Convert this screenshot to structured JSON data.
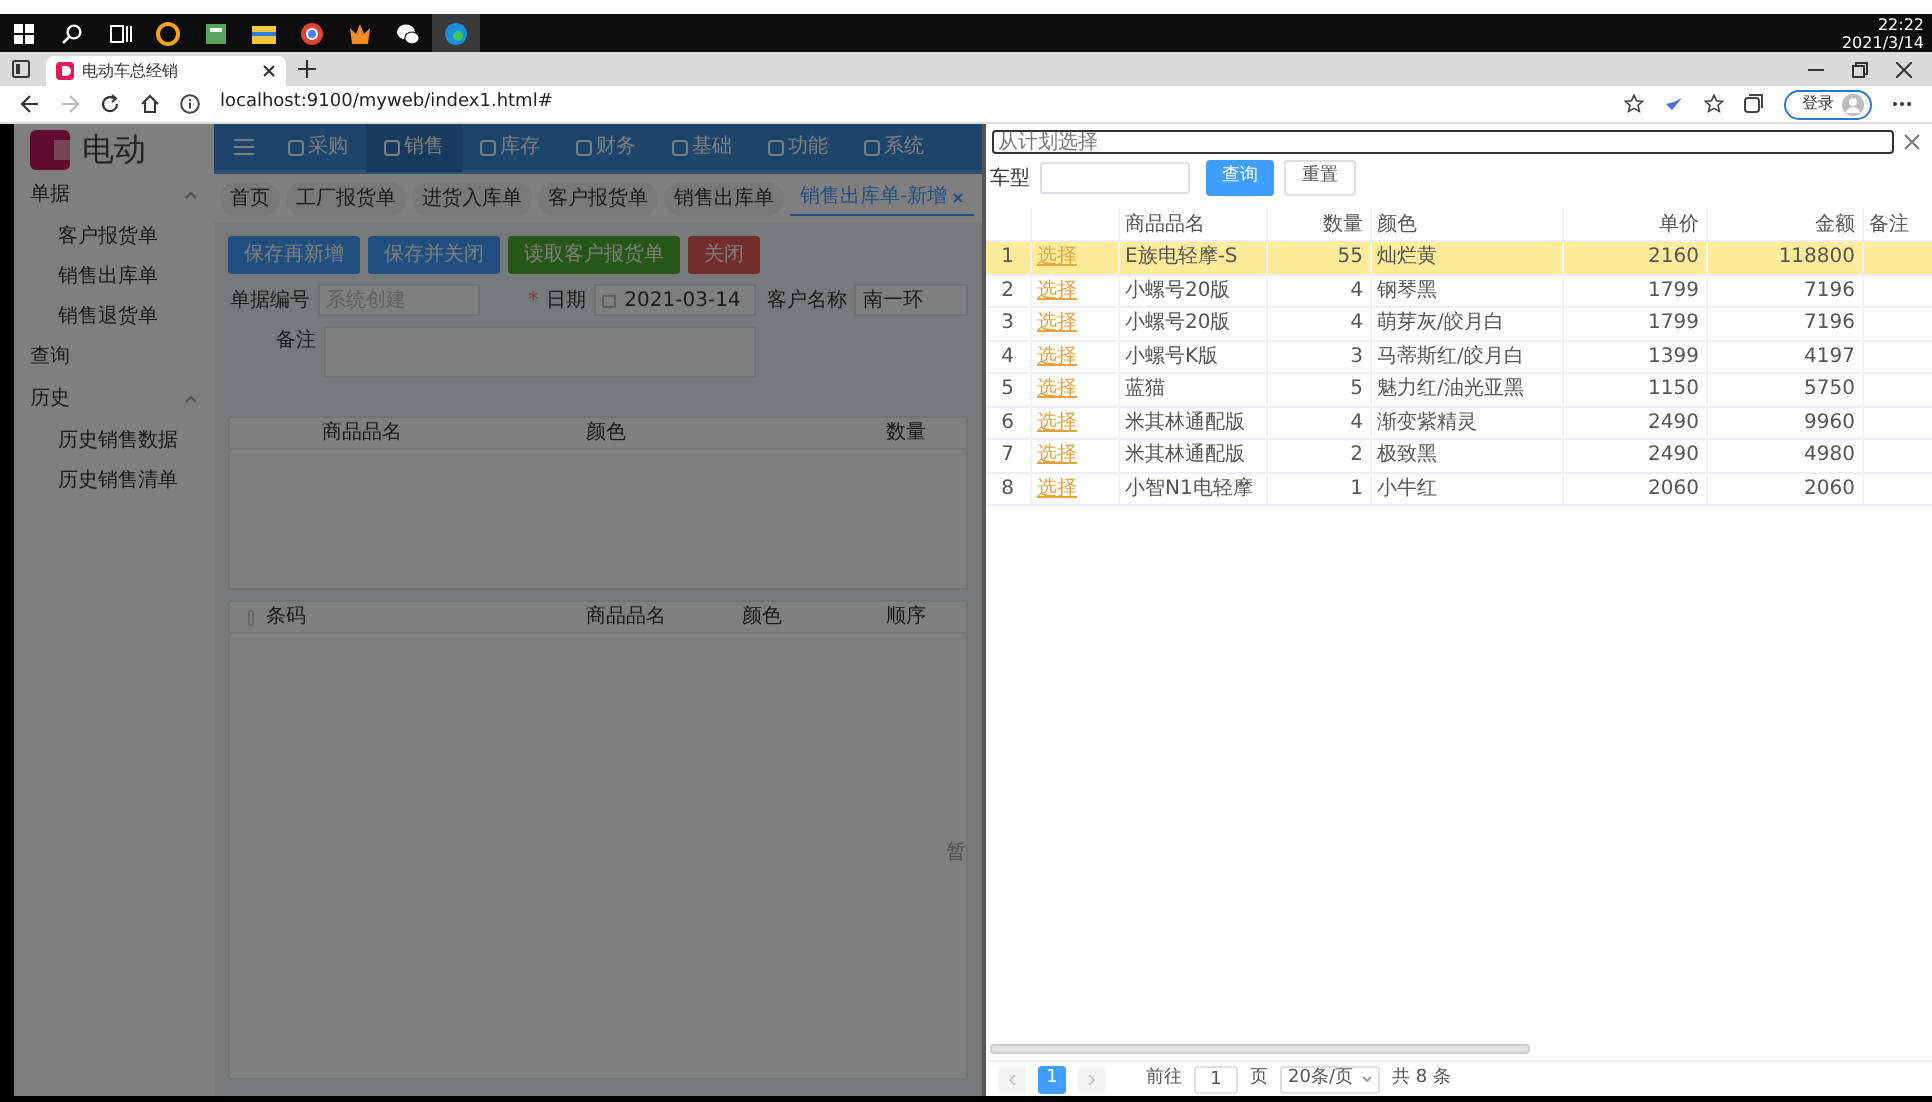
{
  "taskbar": {
    "clock_time": "22:22",
    "clock_date": "2021/3/14"
  },
  "browser": {
    "tab_title": "电动车总经销",
    "url": "localhost:9100/myweb/index1.html#",
    "forward_enabled": false,
    "sign_in": "登录"
  },
  "app": {
    "logo": "电动",
    "sidebar": [
      {
        "label": "单据",
        "expanded": true,
        "children": [
          {
            "label": "客户报货单"
          },
          {
            "label": "销售出库单"
          },
          {
            "label": "销售退货单"
          }
        ]
      },
      {
        "label": "查询"
      },
      {
        "label": "历史",
        "expanded": true,
        "children": [
          {
            "label": "历史销售数据"
          },
          {
            "label": "历史销售清单"
          }
        ]
      }
    ],
    "menu": [
      {
        "label": "采购",
        "selected": false
      },
      {
        "label": "销售",
        "selected": true
      },
      {
        "label": "库存",
        "selected": false
      },
      {
        "label": "财务",
        "selected": false
      },
      {
        "label": "基础",
        "selected": false
      },
      {
        "label": "功能",
        "selected": false
      },
      {
        "label": "系统",
        "selected": false
      }
    ],
    "page_tabs": [
      {
        "label": "首页",
        "selected": false
      },
      {
        "label": "工厂报货单",
        "selected": false
      },
      {
        "label": "进货入库单",
        "selected": false
      },
      {
        "label": "客户报货单",
        "selected": false
      },
      {
        "label": "销售出库单",
        "selected": false
      },
      {
        "label": "销售出库单-新增",
        "selected": true
      }
    ],
    "buttons": [
      {
        "label": "保存再新增",
        "kind": "primary"
      },
      {
        "label": "保存并关闭",
        "kind": "primary"
      },
      {
        "label": "读取客户报货单",
        "kind": "success"
      },
      {
        "label": "关闭",
        "kind": "danger"
      }
    ],
    "form": {
      "doc_no_label": "单据编号",
      "doc_no_placeholder": "系统创建",
      "required_mark": "*",
      "date_label": "日期",
      "date_value": "2021-03-14",
      "customer_label": "客户名称",
      "customer_value": "南一环",
      "remark_label": "备注"
    },
    "upper_table": {
      "columns": [
        "商品品名",
        "颜色",
        "数量"
      ]
    },
    "lower_table": {
      "checked": false,
      "columns": [
        "条码",
        "商品品名",
        "颜色",
        "顺序"
      ],
      "empty_text": "暂"
    }
  },
  "drawer": {
    "title": "从计划选择",
    "filter_label": "车型",
    "search_button": "查询",
    "reset_button": "重置",
    "columns": [
      "商品品名",
      "数量",
      "颜色",
      "单价",
      "金额",
      "备注"
    ],
    "rows": [
      {
        "index": "1",
        "action": "选择",
        "name": "E族电轻摩-S",
        "qty": "55",
        "colour_name": "灿烂黄",
        "price": "2160",
        "amount": "118800",
        "selected": true
      },
      {
        "index": "2",
        "action": "选择",
        "name": "小螺号20版",
        "qty": "4",
        "colour_name": "钢琴黑",
        "price": "1799",
        "amount": "7196",
        "selected": false
      },
      {
        "index": "3",
        "action": "选择",
        "name": "小螺号20版",
        "qty": "4",
        "colour_name": "萌芽灰/皎月白",
        "price": "1799",
        "amount": "7196",
        "selected": false
      },
      {
        "index": "4",
        "action": "选择",
        "name": "小螺号K版",
        "qty": "3",
        "colour_name": "马蒂斯红/皎月白",
        "price": "1399",
        "amount": "4197",
        "selected": false
      },
      {
        "index": "5",
        "action": "选择",
        "name": "蓝猫",
        "qty": "5",
        "colour_name": "魅力红/油光亚黑",
        "price": "1150",
        "amount": "5750",
        "selected": false
      },
      {
        "index": "6",
        "action": "选择",
        "name": "米其林通配版",
        "qty": "4",
        "colour_name": "渐变紫精灵",
        "price": "2490",
        "amount": "9960",
        "selected": false
      },
      {
        "index": "7",
        "action": "选择",
        "name": "米其林通配版",
        "qty": "2",
        "colour_name": "极致黑",
        "price": "2490",
        "amount": "4980",
        "selected": false
      },
      {
        "index": "8",
        "action": "选择",
        "name": "小智N1电轻摩",
        "qty": "1",
        "colour_name": "小牛红",
        "price": "2060",
        "amount": "2060",
        "selected": false
      }
    ],
    "pagination": {
      "prev_enabled": false,
      "pages": [
        {
          "label": "1",
          "selected": true
        }
      ],
      "next_enabled": false,
      "goto_label": "前往",
      "goto_value": "1",
      "page_unit": "页",
      "page_size": "20条/页",
      "total": "共 8 条"
    }
  }
}
